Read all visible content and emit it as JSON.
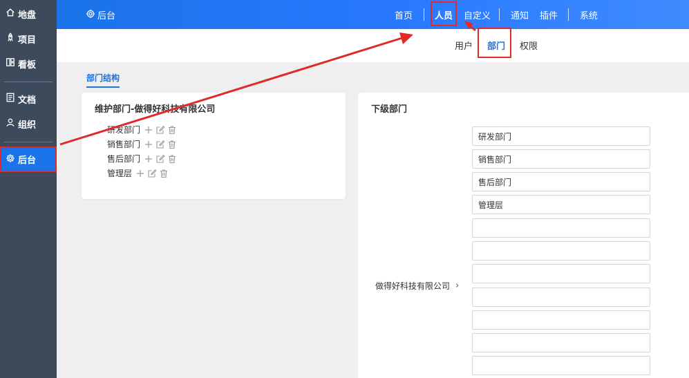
{
  "sidebar": {
    "items": [
      {
        "label": "地盘",
        "icon": "home-icon"
      },
      {
        "label": "项目",
        "icon": "rocket-icon"
      },
      {
        "label": "看板",
        "icon": "board-icon"
      },
      {
        "label": "文档",
        "icon": "document-icon"
      },
      {
        "label": "组织",
        "icon": "user-icon"
      },
      {
        "label": "后台",
        "icon": "gear-icon"
      }
    ]
  },
  "topbar": {
    "brand": "后台",
    "nav": [
      "首页",
      "人员",
      "自定义",
      "通知",
      "插件",
      "系统"
    ],
    "active": "人员"
  },
  "subnav": {
    "tabs": [
      "用户",
      "部门",
      "权限"
    ],
    "active": "部门"
  },
  "section_tab": "部门结构",
  "left_panel": {
    "title": "维护部门-做得好科技有限公司",
    "departments": [
      "研发部门",
      "销售部门",
      "售后部门",
      "管理层"
    ]
  },
  "right_panel": {
    "title": "下级部门",
    "parent_company": "做得好科技有限公司",
    "chevron": "›",
    "fields": [
      "研发部门",
      "销售部门",
      "售后部门",
      "管理层",
      "",
      "",
      "",
      "",
      "",
      "",
      ""
    ]
  },
  "annotations": {
    "highlight_color": "#e02a2a"
  },
  "colors": {
    "sidebar_bg": "#3c4a5c",
    "accent": "#1a73e8"
  }
}
